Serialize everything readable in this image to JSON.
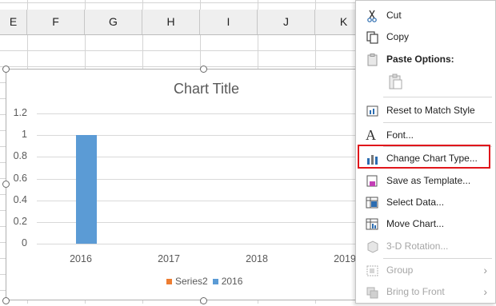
{
  "sheet": {
    "columns": [
      "E",
      "F",
      "G",
      "H",
      "I",
      "J",
      "K"
    ]
  },
  "chart_data": {
    "type": "bar",
    "title": "Chart Title",
    "categories": [
      "2016",
      "2017",
      "2018",
      "2019"
    ],
    "series": [
      {
        "name": "Series2",
        "values": [
          0,
          0,
          0,
          0
        ],
        "color": "#ed7d31"
      },
      {
        "name": "2016",
        "values": [
          1,
          0,
          0,
          0
        ],
        "color": "#5b9bd5"
      }
    ],
    "y_ticks": [
      "0",
      "0.2",
      "0.4",
      "0.6",
      "0.8",
      "1",
      "1.2"
    ],
    "ylim": [
      0,
      1.2
    ],
    "grid": true,
    "legend_position": "bottom"
  },
  "context_menu": {
    "items": {
      "cut": "Cut",
      "copy": "Copy",
      "paste_options": "Paste Options:",
      "reset_style": "Reset to Match Style",
      "font": "Font...",
      "change_chart_type": "Change Chart Type...",
      "save_template": "Save as Template...",
      "select_data": "Select Data...",
      "move_chart": "Move Chart...",
      "rotation": "3-D Rotation...",
      "group": "Group",
      "bring_front": "Bring to Front"
    }
  },
  "colors": {
    "highlight": "#e0161b",
    "bar": "#5b9bd5",
    "series2": "#ed7d31"
  }
}
